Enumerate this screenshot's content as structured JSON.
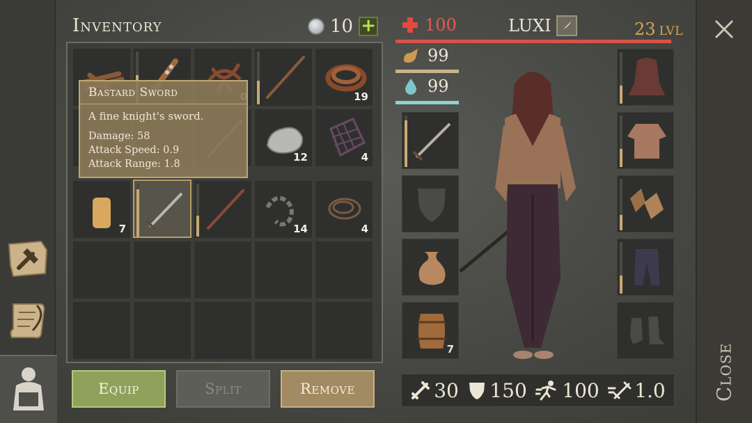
{
  "inventory": {
    "title": "Inventory",
    "coins": "10",
    "add_label": "+",
    "cells": [
      {
        "icon": "logs-icon",
        "qty": "",
        "dur": null
      },
      {
        "icon": "spiked-club-icon",
        "qty": "",
        "dur": 0.55
      },
      {
        "icon": "roots-icon",
        "qty": "0",
        "dur": null
      },
      {
        "icon": "spear-icon",
        "qty": "",
        "dur": 0.45
      },
      {
        "icon": "leather-icon",
        "qty": "19",
        "dur": null
      },
      {
        "icon": "rope-icon",
        "qty": "",
        "dur": null
      },
      {
        "icon": "sword-icon",
        "qty": "",
        "dur": 0.6
      },
      {
        "icon": "stone-icon",
        "qty": "12",
        "dur": null
      },
      {
        "icon": "lattice-icon",
        "qty": "4",
        "dur": null
      },
      {
        "icon": "candle-icon",
        "qty": "7",
        "dur": null
      },
      {
        "icon": "bastard-sword-icon",
        "qty": "",
        "dur": 0.9
      },
      {
        "icon": "spear-icon",
        "qty": "",
        "dur": 0.4
      },
      {
        "icon": "chain-icon",
        "qty": "14",
        "dur": null
      },
      {
        "icon": "wire-icon",
        "qty": "4",
        "dur": null
      }
    ]
  },
  "tooltip": {
    "title": "Bastard Sword",
    "description": "A fine knight's sword.",
    "damage": "Damage: 58",
    "attack_speed": "Attack Speed: 0.9",
    "attack_range": "Attack Range: 1.8"
  },
  "buttons": {
    "equip": "Equip",
    "split": "Split",
    "remove": "Remove"
  },
  "character": {
    "health": "100",
    "name": "LUXI",
    "level": "23",
    "level_unit": "LVL",
    "food": "99",
    "water": "99",
    "food_level": 0.99,
    "water_level": 0.99,
    "barrel_qty": "7"
  },
  "stats": {
    "attack": "30",
    "defense": "150",
    "speed": "100",
    "attack_speed": "1.0"
  },
  "close": {
    "label": "Close"
  },
  "colors": {
    "health": "#d9524a",
    "level": "#d9a552",
    "water": "#8cd2d5",
    "food": "#c9b48a",
    "equip": "#8ea25b"
  }
}
